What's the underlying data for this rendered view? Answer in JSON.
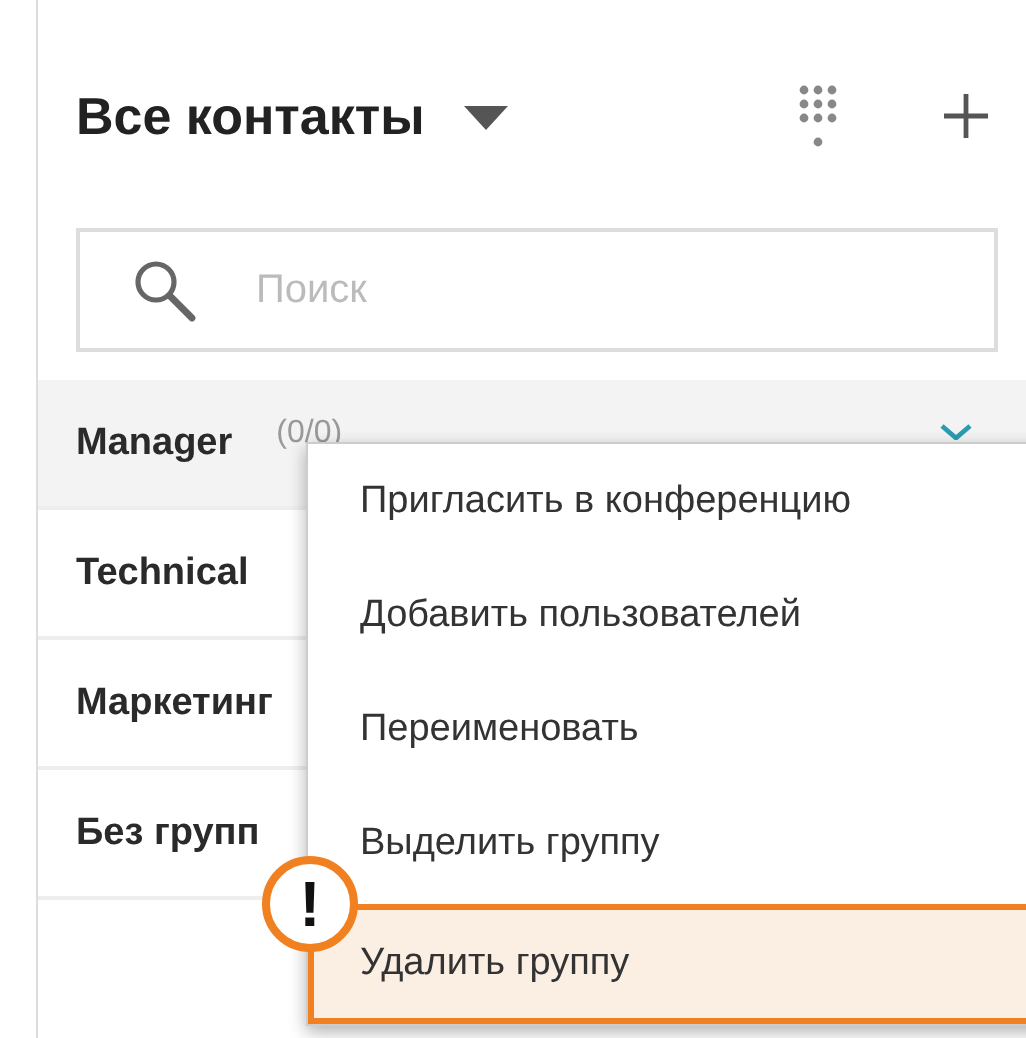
{
  "header": {
    "title": "Все контакты"
  },
  "search": {
    "placeholder": "Поиск"
  },
  "groups": [
    {
      "name": "Manager",
      "count": "(0/0)",
      "selected": true
    },
    {
      "name": "Technical",
      "selected": false
    },
    {
      "name": "Маркетинг",
      "selected": false
    },
    {
      "name": "Без групп",
      "selected": false
    }
  ],
  "context_menu": {
    "items": [
      {
        "label": "Пригласить в конференцию",
        "highlighted": false
      },
      {
        "label": "Добавить пользователей",
        "highlighted": false
      },
      {
        "label": "Переименовать",
        "highlighted": false
      },
      {
        "label": "Выделить группу",
        "highlighted": false
      },
      {
        "label": "Удалить группу",
        "highlighted": true
      }
    ]
  },
  "callout": {
    "mark": "!"
  }
}
